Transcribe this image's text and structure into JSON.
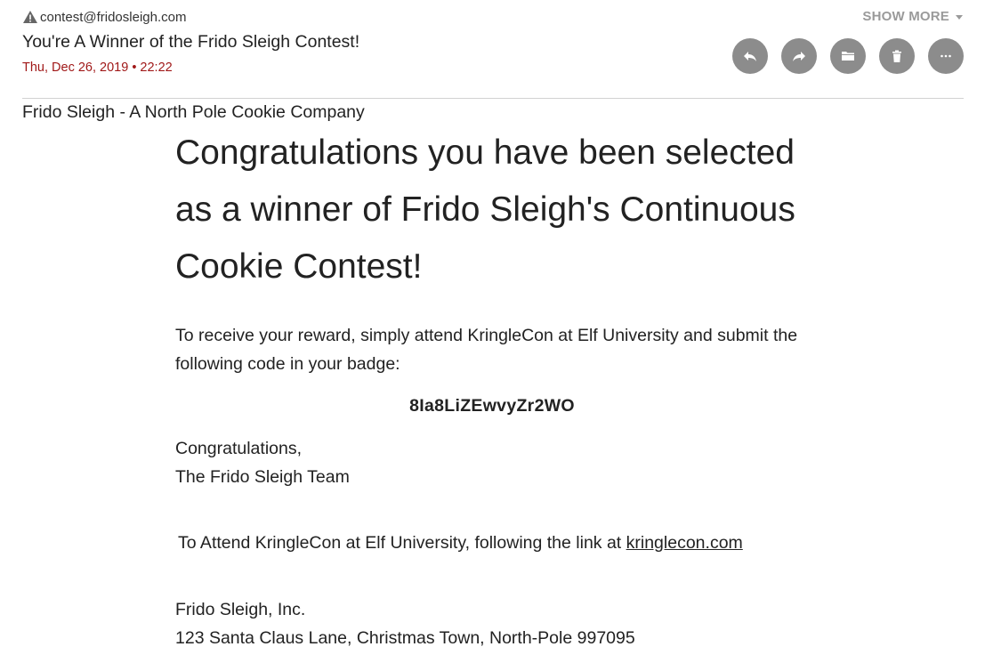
{
  "header": {
    "sender": "contest@fridosleigh.com",
    "subject": "You're A Winner of the Frido Sleigh Contest!",
    "date": "Thu, Dec 26, 2019 • 22:22",
    "show_more": "SHOW MORE"
  },
  "actions": [
    {
      "icon": "reply-icon"
    },
    {
      "icon": "forward-icon"
    },
    {
      "icon": "folder-icon"
    },
    {
      "icon": "trash-icon"
    },
    {
      "icon": "more-icon"
    }
  ],
  "body": {
    "company": "Frido Sleigh - A North Pole Cookie Company",
    "headline": "Congratulations you have been selected as a winner of Frido Sleigh's Continuous Cookie Contest!",
    "instructions": "To receive your reward, simply attend KringleCon at Elf University and submit the following code in your badge:",
    "code": "8Ia8LiZEwvyZr2WO",
    "signoff_line1": "Congratulations,",
    "signoff_line2": "The Frido Sleigh Team",
    "attend_text": "To Attend KringleCon at Elf University, following the link at ",
    "attend_link": "kringlecon.com",
    "address_line1": "Frido Sleigh, Inc.",
    "address_line2": "123 Santa Claus Lane, Christmas Town, North-Pole 997095"
  },
  "colors": {
    "date": "#a01818",
    "button_bg": "#8c8c8c",
    "show_more": "#9a9a9a"
  }
}
